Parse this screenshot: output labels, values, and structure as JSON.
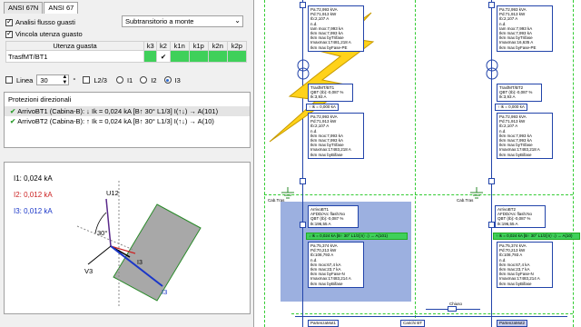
{
  "tabs": [
    "ANSI 67N",
    "ANSI 67"
  ],
  "options": {
    "analisi_flusso": "Analisi flusso guasti",
    "vincola_utenza": "Vincola utenza guasto",
    "combo_value": "Subtransitorio a monte"
  },
  "utenza_table": {
    "headers": [
      "Utenza guasta",
      "k3",
      "k2",
      "k1n",
      "k1p",
      "k2n",
      "k2p"
    ],
    "row_name": "TrasfMT/BT1",
    "k2_mark": "✔"
  },
  "linea": {
    "label": "Linea",
    "angle": "30",
    "unit": "°",
    "l23_label": "L2/3",
    "radios": [
      "I1",
      "I2",
      "I3"
    ],
    "selected_radio": "I3"
  },
  "protezioni": {
    "title": "Protezioni direzionali",
    "rows": [
      "ArrivoBT1 (Cabina-B): ↓ Ik = 0,024 kA [B↑ 30° L1/3] I(↑↓) → A(101)",
      "ArrivoBT2 (Cabina-B): ↑ Ik = 0,024 kA [B↑ 30° L1/3] I(↑↓) → A(10)"
    ]
  },
  "graph": {
    "i1": "I1: 0,024 kA",
    "i2": "I2: 0,012 kA",
    "i3": "I3: 0,012 kA",
    "u12": "U12",
    "v3": "V3",
    "deg": "30°",
    "i3_tip": "I3",
    "i3_mid": "I3",
    "colors": {
      "i1": "#000000",
      "i2": "#cc2222",
      "i3": "#1a36c8",
      "sector": "#a8a8a8"
    }
  },
  "diagram": {
    "box_top1": [
      "Pa:72,993 kVA",
      "Pd:71,913 kW",
      "Ib:2,107 A",
      "n.d.",
      "Iam mox:7,993 kA",
      "Ikm max:7,993 kA",
      "Ikm max byTrifase",
      "Imaxmax:17481,218 A",
      "Ikm max byFase-PE"
    ],
    "box_top2": [
      "Pa:72,993 kVA",
      "Pd:71,913 kW",
      "Ib:2,107 A",
      "n.d.",
      "Iam mox:7,993 kA",
      "Ikm max:7,993 kA",
      "Ikm max byTrifase",
      "Imaxmax:16,635 A",
      "Ikm max byFase-PE"
    ],
    "trasf1_label": [
      "TrasfMT/BT1",
      "QBT (Ib):-0,087 %",
      "Ik:3,93 A"
    ],
    "trasf2_label": [
      "TrasfMT/BT2",
      "QBT (Ib):-0,087 %",
      "Ik:3,93 A"
    ],
    "ik_bar_left": "↑ Ik = 0,000 kA",
    "ik_bar_right": "↑ Ik = 0,000 kA",
    "box_mid1": [
      "Pa:72,993 kVA",
      "Pd:71,913 kW",
      "Ib:2,107 A",
      "n.d.",
      "Ikm mox:7,993 kA",
      "Ikm max:7,993 kA",
      "Ikm max byTrifase",
      "Imaxmax:17483,218 A",
      "Ikm max byBifase"
    ],
    "box_mid2": [
      "Pa:72,993 kVA",
      "Pd:71,913 kW",
      "Ib:2,107 A",
      "n.d.",
      "Ikm mox:7,993 kA",
      "Ikm max:7,993 kA",
      "Ikm max byTrifase",
      "Imaxmax:17483,218 A",
      "Ikm max byBifase"
    ],
    "arrivo1_label": [
      "ArrivoBT1",
      "AFDD/Arc flash:No",
      "QBT (Ib):-0,087 %",
      "Ik:196,55 A"
    ],
    "arrivo2_label": [
      "ArrivoBT2",
      "AFDD/Arc flash:No",
      "QBT (Ib):-0,087 %",
      "Ik:196,55 A"
    ],
    "green_left": "↓ Ik = 0,024 kA [B↑ 30° L1/3] I(↑↓) → A(101)",
    "green_right": "↑ Ik = 0,024 kA [B↑ 30° L1/3] I(↑↓) → A(10)",
    "box_low1": [
      "Pa:75,374 kVA",
      "Pd:70,213 kW",
      "Ib:108,793 A",
      "n.d.",
      "Ikm mox:67,4 kA",
      "Ikm max:23,7 kA",
      "Ikm max byFase-N",
      "Imaxmax:17483,214 A",
      "Ikm max byBifase"
    ],
    "box_low2": [
      "Pa:75,374 kVA",
      "Pd:70,213 kW",
      "Ib:108,793 A",
      "n.d.",
      "Ikm mox:67,4 kA",
      "Ikm max:23,7 kA",
      "Ikm max byFase-N",
      "Imaxmax:17483,214 A",
      "Ikm max byBifase"
    ],
    "tn_left": "Cab.Tras",
    "tn_right": "Cab.Tras",
    "chiuso": "Chiuso",
    "bottom_labels": [
      "PartenzaMot1",
      "Carichi BT",
      "PartenzaMot2"
    ]
  }
}
